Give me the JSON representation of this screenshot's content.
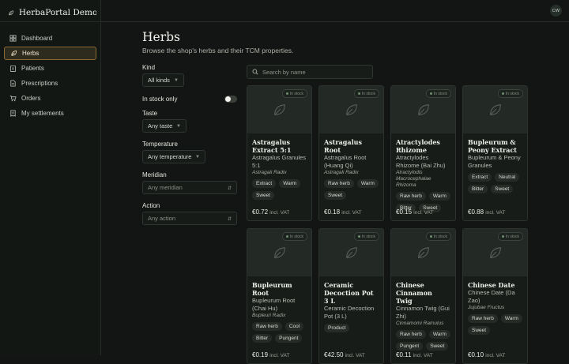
{
  "app": {
    "brand": "HerbaPortal Demo ...",
    "avatar_initials": "CW"
  },
  "sidebar": {
    "items": [
      {
        "label": "Dashboard",
        "icon": "grid-icon"
      },
      {
        "label": "Herbs",
        "icon": "leaf-icon",
        "active": true
      },
      {
        "label": "Patients",
        "icon": "clipboard-icon"
      },
      {
        "label": "Prescriptions",
        "icon": "document-icon"
      },
      {
        "label": "Orders",
        "icon": "cart-icon"
      },
      {
        "label": "My settlements",
        "icon": "receipt-icon"
      }
    ]
  },
  "page": {
    "title": "Herbs",
    "subtitle": "Browse the shop's herbs and their TCM properties."
  },
  "filters": {
    "kind_label": "Kind",
    "kind_value": "All kinds",
    "in_stock_label": "In stock only",
    "in_stock_on": false,
    "taste_label": "Taste",
    "taste_value": "Any taste",
    "temperature_label": "Temperature",
    "temperature_value": "Any temperature",
    "meridian_label": "Meridian",
    "meridian_value": "Any meridian",
    "action_label": "Action",
    "action_value": "Any action"
  },
  "search": {
    "placeholder": "Search by name"
  },
  "stock_label": "In stock",
  "vat_label": "incl. VAT",
  "cards": [
    {
      "title": "Astragalus Extract 5:1",
      "subtitle": "Astragalus Granules 5:1",
      "latin": "Astragali Radix",
      "tags": [
        "Extract",
        "Warm",
        "Sweet"
      ],
      "price": "€0.72"
    },
    {
      "title": "Astragalus Root",
      "subtitle": "Astragalus Root (Huang Qi)",
      "latin": "Astragali Radix",
      "tags": [
        "Raw herb",
        "Warm",
        "Sweet"
      ],
      "price": "€0.18"
    },
    {
      "title": "Atractylodes Rhizome",
      "subtitle": "Atractylodes Rhizome (Bai Zhu)",
      "latin": "Atractylodis Macrocephalae Rhizoma",
      "tags": [
        "Raw herb",
        "Warm",
        "Bitter",
        "Sweet"
      ],
      "price": "€0.15"
    },
    {
      "title": "Bupleurum & Peony Extract",
      "subtitle": "Bupleurum & Peony Granules",
      "latin": "",
      "tags": [
        "Extract",
        "Neutral",
        "Bitter",
        "Sweet"
      ],
      "price": "€0.88"
    },
    {
      "title": "Bupleurum Root",
      "subtitle": "Bupleurum Root (Chai Hu)",
      "latin": "Bupleuri Radix",
      "tags": [
        "Raw herb",
        "Cool",
        "Bitter",
        "Pungent"
      ],
      "price": "€0.19"
    },
    {
      "title": "Ceramic Decoction Pot 3 L",
      "subtitle": "Ceramic Decoction Pot (3 L)",
      "latin": "",
      "tags": [
        "Product"
      ],
      "price": "€42.50"
    },
    {
      "title": "Chinese Cinnamon Twig",
      "subtitle": "Cinnamon Twig (Gui Zhi)",
      "latin": "Cinnamomi Ramulus",
      "tags": [
        "Raw herb",
        "Warm",
        "Pungent",
        "Sweet"
      ],
      "price": "€0.11"
    },
    {
      "title": "Chinese Date",
      "subtitle": "Chinese Date (Da Zao)",
      "latin": "Jujubae Fructus",
      "tags": [
        "Raw herb",
        "Warm",
        "Sweet"
      ],
      "price": "€0.10"
    }
  ]
}
